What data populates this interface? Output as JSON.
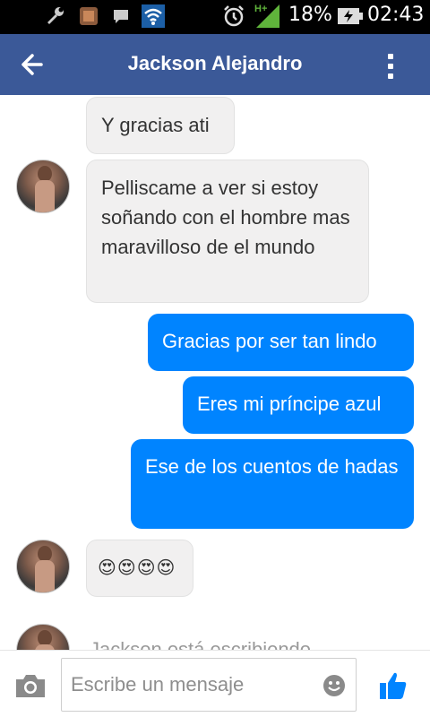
{
  "status_bar": {
    "icons": [
      "wrench-icon",
      "gallery-icon",
      "chat-icon",
      "wifi-icon",
      "alarm-icon",
      "signal-icon",
      "battery-icon"
    ],
    "network_label": "H+",
    "battery_percent": "18%",
    "time": "02:43"
  },
  "header": {
    "title": "Jackson Alejandro",
    "color": "#3b5998"
  },
  "messages": [
    {
      "from": "them",
      "text": "Y gracias ati"
    },
    {
      "from": "them",
      "text": "Pelliscame a ver si estoy soñando con el hombre mas maravilloso de el mundo"
    },
    {
      "from": "me",
      "text": "Gracias por ser tan lindo"
    },
    {
      "from": "me",
      "text": "Eres mi príncipe azul"
    },
    {
      "from": "me",
      "text": "Ese de los cuentos de hadas"
    },
    {
      "from": "them",
      "text": "😍😍😍😍"
    }
  ],
  "typing_indicator": "Jackson está escribiendo...",
  "composer": {
    "placeholder": "Escribe un mensaje"
  },
  "colors": {
    "outgoing_bubble": "#0084ff",
    "incoming_bubble": "#f1f0f0",
    "like_button": "#0084ff"
  }
}
